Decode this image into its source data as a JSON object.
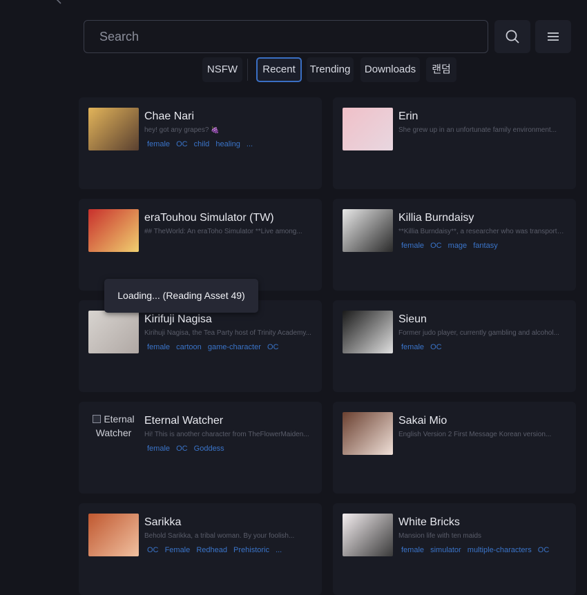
{
  "search": {
    "placeholder": "Search"
  },
  "tabs": [
    {
      "label": "NSFW",
      "active": false
    },
    {
      "label": "Recent",
      "active": true
    },
    {
      "label": "Trending",
      "active": false
    },
    {
      "label": "Downloads",
      "active": false
    },
    {
      "label": "랜덤",
      "active": false
    }
  ],
  "cards": [
    {
      "title": "Chae Nari",
      "desc": "hey! got any grapes? 🍇",
      "tags": [
        "female",
        "OC",
        "child",
        "healing",
        "..."
      ],
      "thumb_colors": [
        "#e2b45a",
        "#5a4030"
      ]
    },
    {
      "title": "Erin",
      "desc": "She grew up in an unfortunate family environment...",
      "tags": [],
      "thumb_colors": [
        "#f0c0c8",
        "#e8d7e0"
      ]
    },
    {
      "title": "eraTouhou Simulator (TW)",
      "desc": "## TheWorld: An eraToho Simulator **Live among...",
      "tags": [],
      "thumb_colors": [
        "#c8302c",
        "#f0d070"
      ]
    },
    {
      "title": "Killia Burndaisy",
      "desc": "**Killia Burndaisy**, a researcher who was transported...",
      "tags": [
        "female",
        "OC",
        "mage",
        "fantasy"
      ],
      "thumb_colors": [
        "#e8e8e8",
        "#2a2a2a"
      ]
    },
    {
      "title": "Kirifuji Nagisa",
      "desc": "Kirihuji Nagisa, the Tea Party host of Trinity Academy...",
      "tags": [
        "female",
        "cartoon",
        "game-character",
        "OC"
      ],
      "thumb_colors": [
        "#d8d4d0",
        "#b0a8a4"
      ]
    },
    {
      "title": "Sieun",
      "desc": "Former judo player, currently gambling and alcohol...",
      "tags": [
        "female",
        "OC"
      ],
      "thumb_colors": [
        "#1a1a1a",
        "#e0e0e0"
      ]
    },
    {
      "title": "Eternal Watcher",
      "desc": "Hi! This is another character from TheFlowerMaiden...",
      "tags": [
        "female",
        "OC",
        "Goddess"
      ],
      "broken_alt": "Eternal Watcher"
    },
    {
      "title": "Sakai Mio",
      "desc": "English Version 2 First Message Korean version...",
      "tags": [],
      "thumb_colors": [
        "#6a4030",
        "#f0e0d8"
      ]
    },
    {
      "title": "Sarikka",
      "desc": "Behold Sarikka, a tribal woman. By your foolish...",
      "tags": [
        "OC",
        "Female",
        "Redhead",
        "Prehistoric",
        "..."
      ],
      "thumb_colors": [
        "#c05830",
        "#f0c0a0"
      ]
    },
    {
      "title": "White Bricks",
      "desc": "Mansion life with ten maids",
      "tags": [
        "female",
        "simulator",
        "multiple-characters",
        "OC"
      ],
      "thumb_colors": [
        "#f4eef0",
        "#3a3a3a"
      ]
    }
  ],
  "loading": {
    "text": "Loading... (Reading Asset 49)"
  },
  "icons": {
    "back": "arrow-left-icon",
    "search": "search-icon",
    "menu": "hamburger-menu-icon"
  }
}
